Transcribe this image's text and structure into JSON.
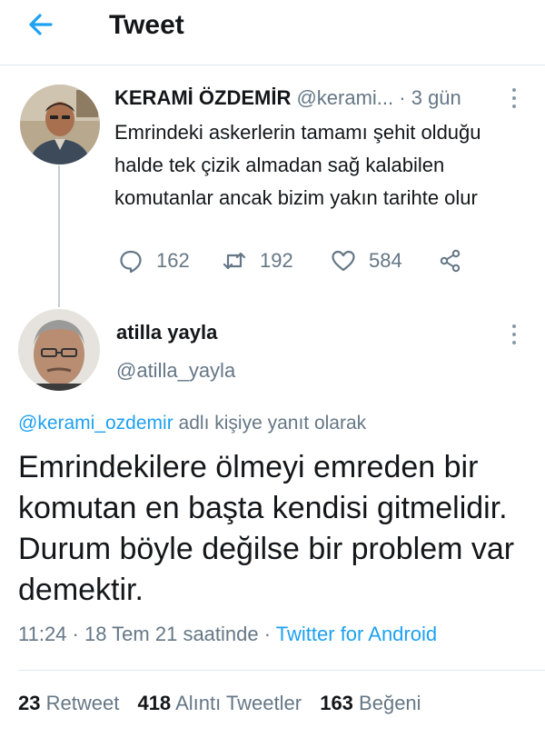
{
  "header": {
    "title": "Tweet",
    "back_icon": "arrow-left-icon",
    "accent_color": "#1da1f2"
  },
  "parent_tweet": {
    "author_name": "KERAMİ ÖZDEMİR",
    "author_handle": "@kerami...",
    "separator": "·",
    "time": "3 gün",
    "text": "Emrindeki askerlerin tamamı şehit olduğu halde tek çizik almadan sağ kalabilen komutanlar ancak bizim yakın tarihte olur",
    "reply_count": "162",
    "retweet_count": "192",
    "like_count": "584"
  },
  "main_tweet": {
    "author_name": "atilla yayla",
    "author_handle": "@atilla_yayla",
    "replying_mention": "@kerami_ozdemir",
    "replying_suffix": "adlı kişiye yanıt olarak",
    "text": "Emrindekilere ölmeyi emreden bir komutan en başta kendisi gitmelidir. Durum böyle değilse bir problem var demektir.",
    "time": "11:24",
    "separator": "·",
    "date": "18 Tem 21 saatinde",
    "source": "Twitter for Android",
    "stats": {
      "retweets_count": "23",
      "retweets_label": "Retweet",
      "quotes_count": "418",
      "quotes_label": "Alıntı Tweetler",
      "likes_count": "163",
      "likes_label": "Beğeni"
    }
  }
}
